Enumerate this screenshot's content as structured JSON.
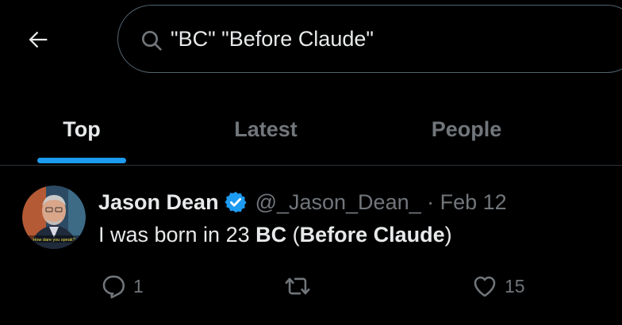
{
  "header": {
    "back_icon": "arrow-left-icon",
    "search": {
      "icon": "search-icon",
      "value": "\"BC\" \"Before Claude\""
    }
  },
  "tabs": [
    {
      "label": "Top",
      "active": true
    },
    {
      "label": "Latest",
      "active": false
    },
    {
      "label": "People",
      "active": false
    }
  ],
  "colors": {
    "accent": "#1d9bf0",
    "text_primary": "#e7e9ea",
    "text_secondary": "#71767b",
    "background": "#000000",
    "border": "#2f3336"
  },
  "tweet": {
    "author": {
      "name": "Jason Dean",
      "handle": "@_Jason_Dean_",
      "verified": true,
      "avatar_caption": "How dare you speak?"
    },
    "separator": " · ",
    "date": "Feb 12",
    "text_parts": {
      "p1": "I was born in 23 ",
      "b1": "BC",
      "p2": " (",
      "b2": "Before Claude",
      "p3": ")"
    },
    "actions": {
      "reply": {
        "icon": "reply-icon",
        "count": "1"
      },
      "retweet": {
        "icon": "retweet-icon",
        "count": ""
      },
      "like": {
        "icon": "heart-icon",
        "count": "15"
      }
    }
  }
}
